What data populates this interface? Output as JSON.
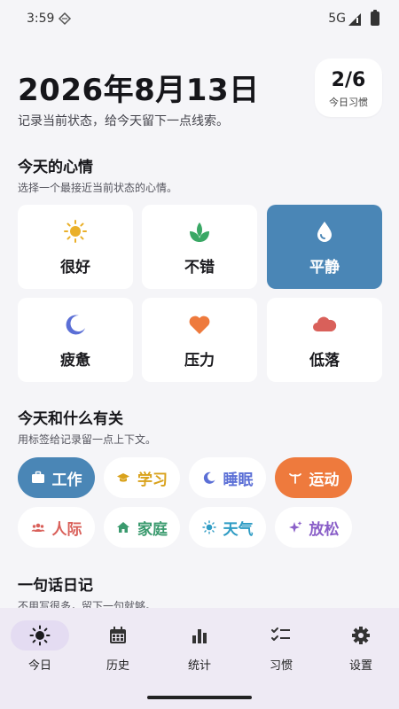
{
  "status": {
    "time": "3:59",
    "network": "5G"
  },
  "header": {
    "date": "2026年8月13日",
    "subtitle": "记录当前状态，给今天留下一点线索。",
    "habit_count": "2/6",
    "habit_label": "今日习惯"
  },
  "mood_section": {
    "title": "今天的心情",
    "subtitle": "选择一个最接近当前状态的心情。",
    "selected": "平静",
    "items": [
      {
        "label": "很好",
        "icon": "sun-icon",
        "color": "#eab02a"
      },
      {
        "label": "不错",
        "icon": "sprout-icon",
        "color": "#3aa865"
      },
      {
        "label": "平静",
        "icon": "droplet-icon",
        "color": "#ffffff"
      },
      {
        "label": "疲惫",
        "icon": "moon-icon",
        "color": "#5b6fd6"
      },
      {
        "label": "压力",
        "icon": "heart-icon",
        "color": "#ee7a3d"
      },
      {
        "label": "低落",
        "icon": "cloud-icon",
        "color": "#d9605a"
      }
    ]
  },
  "tag_section": {
    "title": "今天和什么有关",
    "subtitle": "用标签给记录留一点上下文。",
    "tags": [
      {
        "label": "工作",
        "icon": "briefcase-icon",
        "color": "#ffffff",
        "selected": true
      },
      {
        "label": "学习",
        "icon": "graduation-cap-icon",
        "color": "#d9a21c",
        "selected": false
      },
      {
        "label": "睡眠",
        "icon": "moon-icon",
        "color": "#5b6fd6",
        "selected": false
      },
      {
        "label": "运动",
        "icon": "running-icon",
        "color": "#ffffff",
        "selected": true
      },
      {
        "label": "人际",
        "icon": "people-icon",
        "color": "#d9605a",
        "selected": false
      },
      {
        "label": "家庭",
        "icon": "home-icon",
        "color": "#3a9a6e",
        "selected": false
      },
      {
        "label": "天气",
        "icon": "sun-icon",
        "color": "#2f9cc4",
        "selected": false
      },
      {
        "label": "放松",
        "icon": "sparkle-icon",
        "color": "#8a5fc8",
        "selected": false
      }
    ]
  },
  "diary_section": {
    "title": "一句话日记",
    "subtitle": "不用写很多，留下一句就够。"
  },
  "nav": {
    "active": "今日",
    "items": [
      {
        "label": "今日",
        "icon": "sun-icon"
      },
      {
        "label": "历史",
        "icon": "calendar-icon"
      },
      {
        "label": "统计",
        "icon": "bar-chart-icon"
      },
      {
        "label": "习惯",
        "icon": "checklist-icon"
      },
      {
        "label": "设置",
        "icon": "gear-icon"
      }
    ]
  }
}
